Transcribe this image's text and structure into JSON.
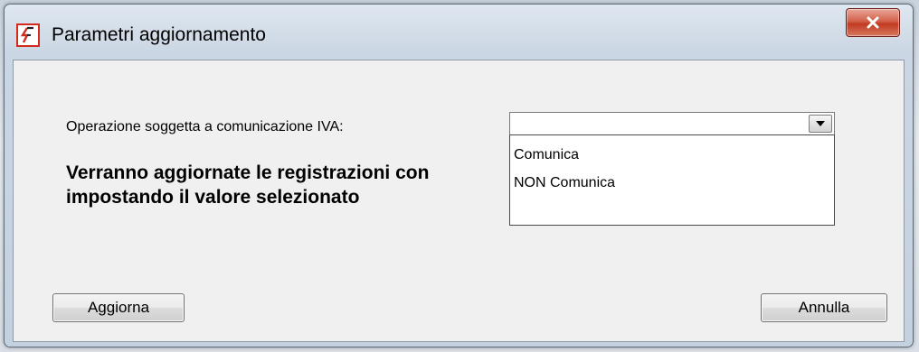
{
  "window": {
    "title": "Parametri aggiornamento"
  },
  "form": {
    "field_label": "Operazione soggetta a comunicazione IVA:",
    "selected_value": "",
    "options": [
      "Comunica",
      "NON Comunica"
    ],
    "message_line1": "Verranno aggiornate le registrazioni con",
    "message_line2": "impostando il valore selezionato"
  },
  "buttons": {
    "update_label": "Aggiorna",
    "cancel_label": "Annulla"
  },
  "colors": {
    "close_button": "#c23a22",
    "app_icon": "#d22a1e"
  },
  "icons": {
    "app": "app-logo-icon",
    "close": "close-icon",
    "dropdown": "chevron-down-icon"
  }
}
